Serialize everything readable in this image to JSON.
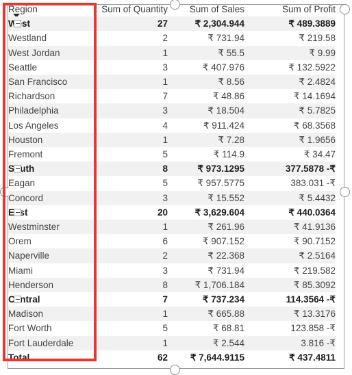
{
  "visual": {
    "type": "pivot-table",
    "highlight_color": "#e8372e",
    "header_underline_color": "#9fc5e8",
    "stripe_color": "#f1f1f1"
  },
  "header": {
    "region_label": "Region",
    "filter_icon": "filter-dropdown-arrow",
    "columns": [
      "Sum of Quantity",
      "Sum of Sales",
      "Sum of Profit"
    ]
  },
  "rows": [
    {
      "label": "West",
      "level": "group",
      "icon": "collapse-minus-icon",
      "quantity": "27",
      "sales": "₹ 2,304.944",
      "profit": "₹ 489.3889"
    },
    {
      "label": "Westland",
      "level": "child",
      "quantity": "2",
      "sales": "₹ 731.94",
      "profit": "₹ 219.58"
    },
    {
      "label": "West Jordan",
      "level": "child",
      "quantity": "1",
      "sales": "₹ 55.5",
      "profit": "₹ 9.99"
    },
    {
      "label": "Seattle",
      "level": "child",
      "quantity": "3",
      "sales": "₹ 407.976",
      "profit": "₹ 132.5922"
    },
    {
      "label": "San Francisco",
      "level": "child",
      "quantity": "1",
      "sales": "₹ 8.56",
      "profit": "₹ 2.4824"
    },
    {
      "label": "Richardson",
      "level": "child",
      "quantity": "7",
      "sales": "₹ 48.86",
      "profit": "₹ 14.1694"
    },
    {
      "label": "Philadelphia",
      "level": "child",
      "quantity": "3",
      "sales": "₹ 18.504",
      "profit": "₹ 5.7825"
    },
    {
      "label": "Los Angeles",
      "level": "child",
      "quantity": "4",
      "sales": "₹ 911.424",
      "profit": "₹ 68.3568"
    },
    {
      "label": "Houston",
      "level": "child",
      "quantity": "1",
      "sales": "₹ 7.28",
      "profit": "₹ 1.9656"
    },
    {
      "label": "Fremont",
      "level": "child",
      "quantity": "5",
      "sales": "₹ 114.9",
      "profit": "₹ 34.47"
    },
    {
      "label": "South",
      "level": "group",
      "icon": "collapse-minus-icon",
      "quantity": "8",
      "sales": "₹ 973.1295",
      "profit": "377.5878 -₹"
    },
    {
      "label": "Eagan",
      "level": "child",
      "quantity": "5",
      "sales": "₹ 957.5775",
      "profit": "383.031 -₹"
    },
    {
      "label": "Concord",
      "level": "child",
      "quantity": "3",
      "sales": "₹ 15.552",
      "profit": "₹ 5.4432"
    },
    {
      "label": "East",
      "level": "group",
      "icon": "collapse-minus-icon",
      "quantity": "20",
      "sales": "₹ 3,629.604",
      "profit": "₹ 440.0364"
    },
    {
      "label": "Westminster",
      "level": "child",
      "quantity": "1",
      "sales": "₹ 261.96",
      "profit": "₹ 41.9136"
    },
    {
      "label": "Orem",
      "level": "child",
      "quantity": "6",
      "sales": "₹ 907.152",
      "profit": "₹ 90.7152"
    },
    {
      "label": "Naperville",
      "level": "child",
      "quantity": "2",
      "sales": "₹ 22.368",
      "profit": "₹ 2.5164"
    },
    {
      "label": "Miami",
      "level": "child",
      "quantity": "3",
      "sales": "₹ 731.94",
      "profit": "₹ 219.582"
    },
    {
      "label": "Henderson",
      "level": "child",
      "quantity": "8",
      "sales": "₹ 1,706.184",
      "profit": "₹ 85.3092"
    },
    {
      "label": "Central",
      "level": "group",
      "icon": "collapse-minus-icon",
      "quantity": "7",
      "sales": "₹ 737.234",
      "profit": "114.3564 -₹"
    },
    {
      "label": "Madison",
      "level": "child",
      "quantity": "1",
      "sales": "₹ 665.88",
      "profit": "₹ 13.3176"
    },
    {
      "label": "Fort Worth",
      "level": "child",
      "quantity": "5",
      "sales": "₹ 68.81",
      "profit": "123.858 -₹"
    },
    {
      "label": "Fort Lauderdale",
      "level": "child",
      "quantity": "1",
      "sales": "₹ 2.544",
      "profit": "3.816 -₹"
    },
    {
      "label": "Total",
      "level": "total",
      "quantity": "62",
      "sales": "₹ 7,644.9115",
      "profit": "₹ 437.4811"
    }
  ]
}
